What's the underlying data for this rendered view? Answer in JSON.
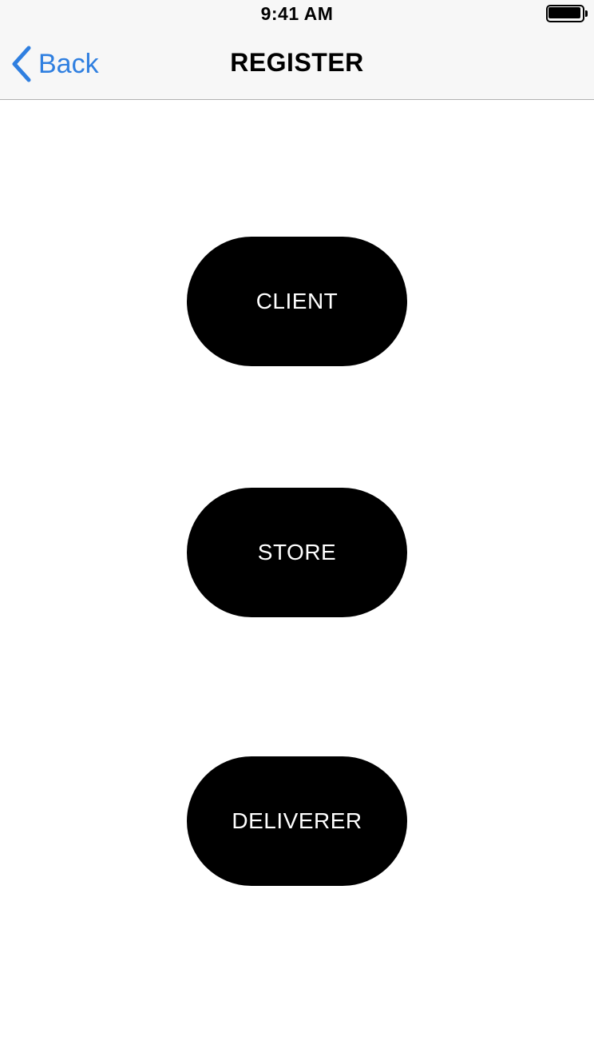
{
  "status_bar": {
    "time": "9:41 AM",
    "battery_level": 1.0
  },
  "nav": {
    "back_label": "Back",
    "title": "REGISTER"
  },
  "roles": {
    "client_label": "CLIENT",
    "store_label": "STORE",
    "deliverer_label": "DELIVERER"
  },
  "colors": {
    "accent": "#2f7fe0",
    "button_background": "#000000",
    "button_text": "#ffffff",
    "bar_background": "#f7f7f7"
  },
  "icons": {
    "back": "chevron-left-icon",
    "battery": "battery-icon"
  }
}
